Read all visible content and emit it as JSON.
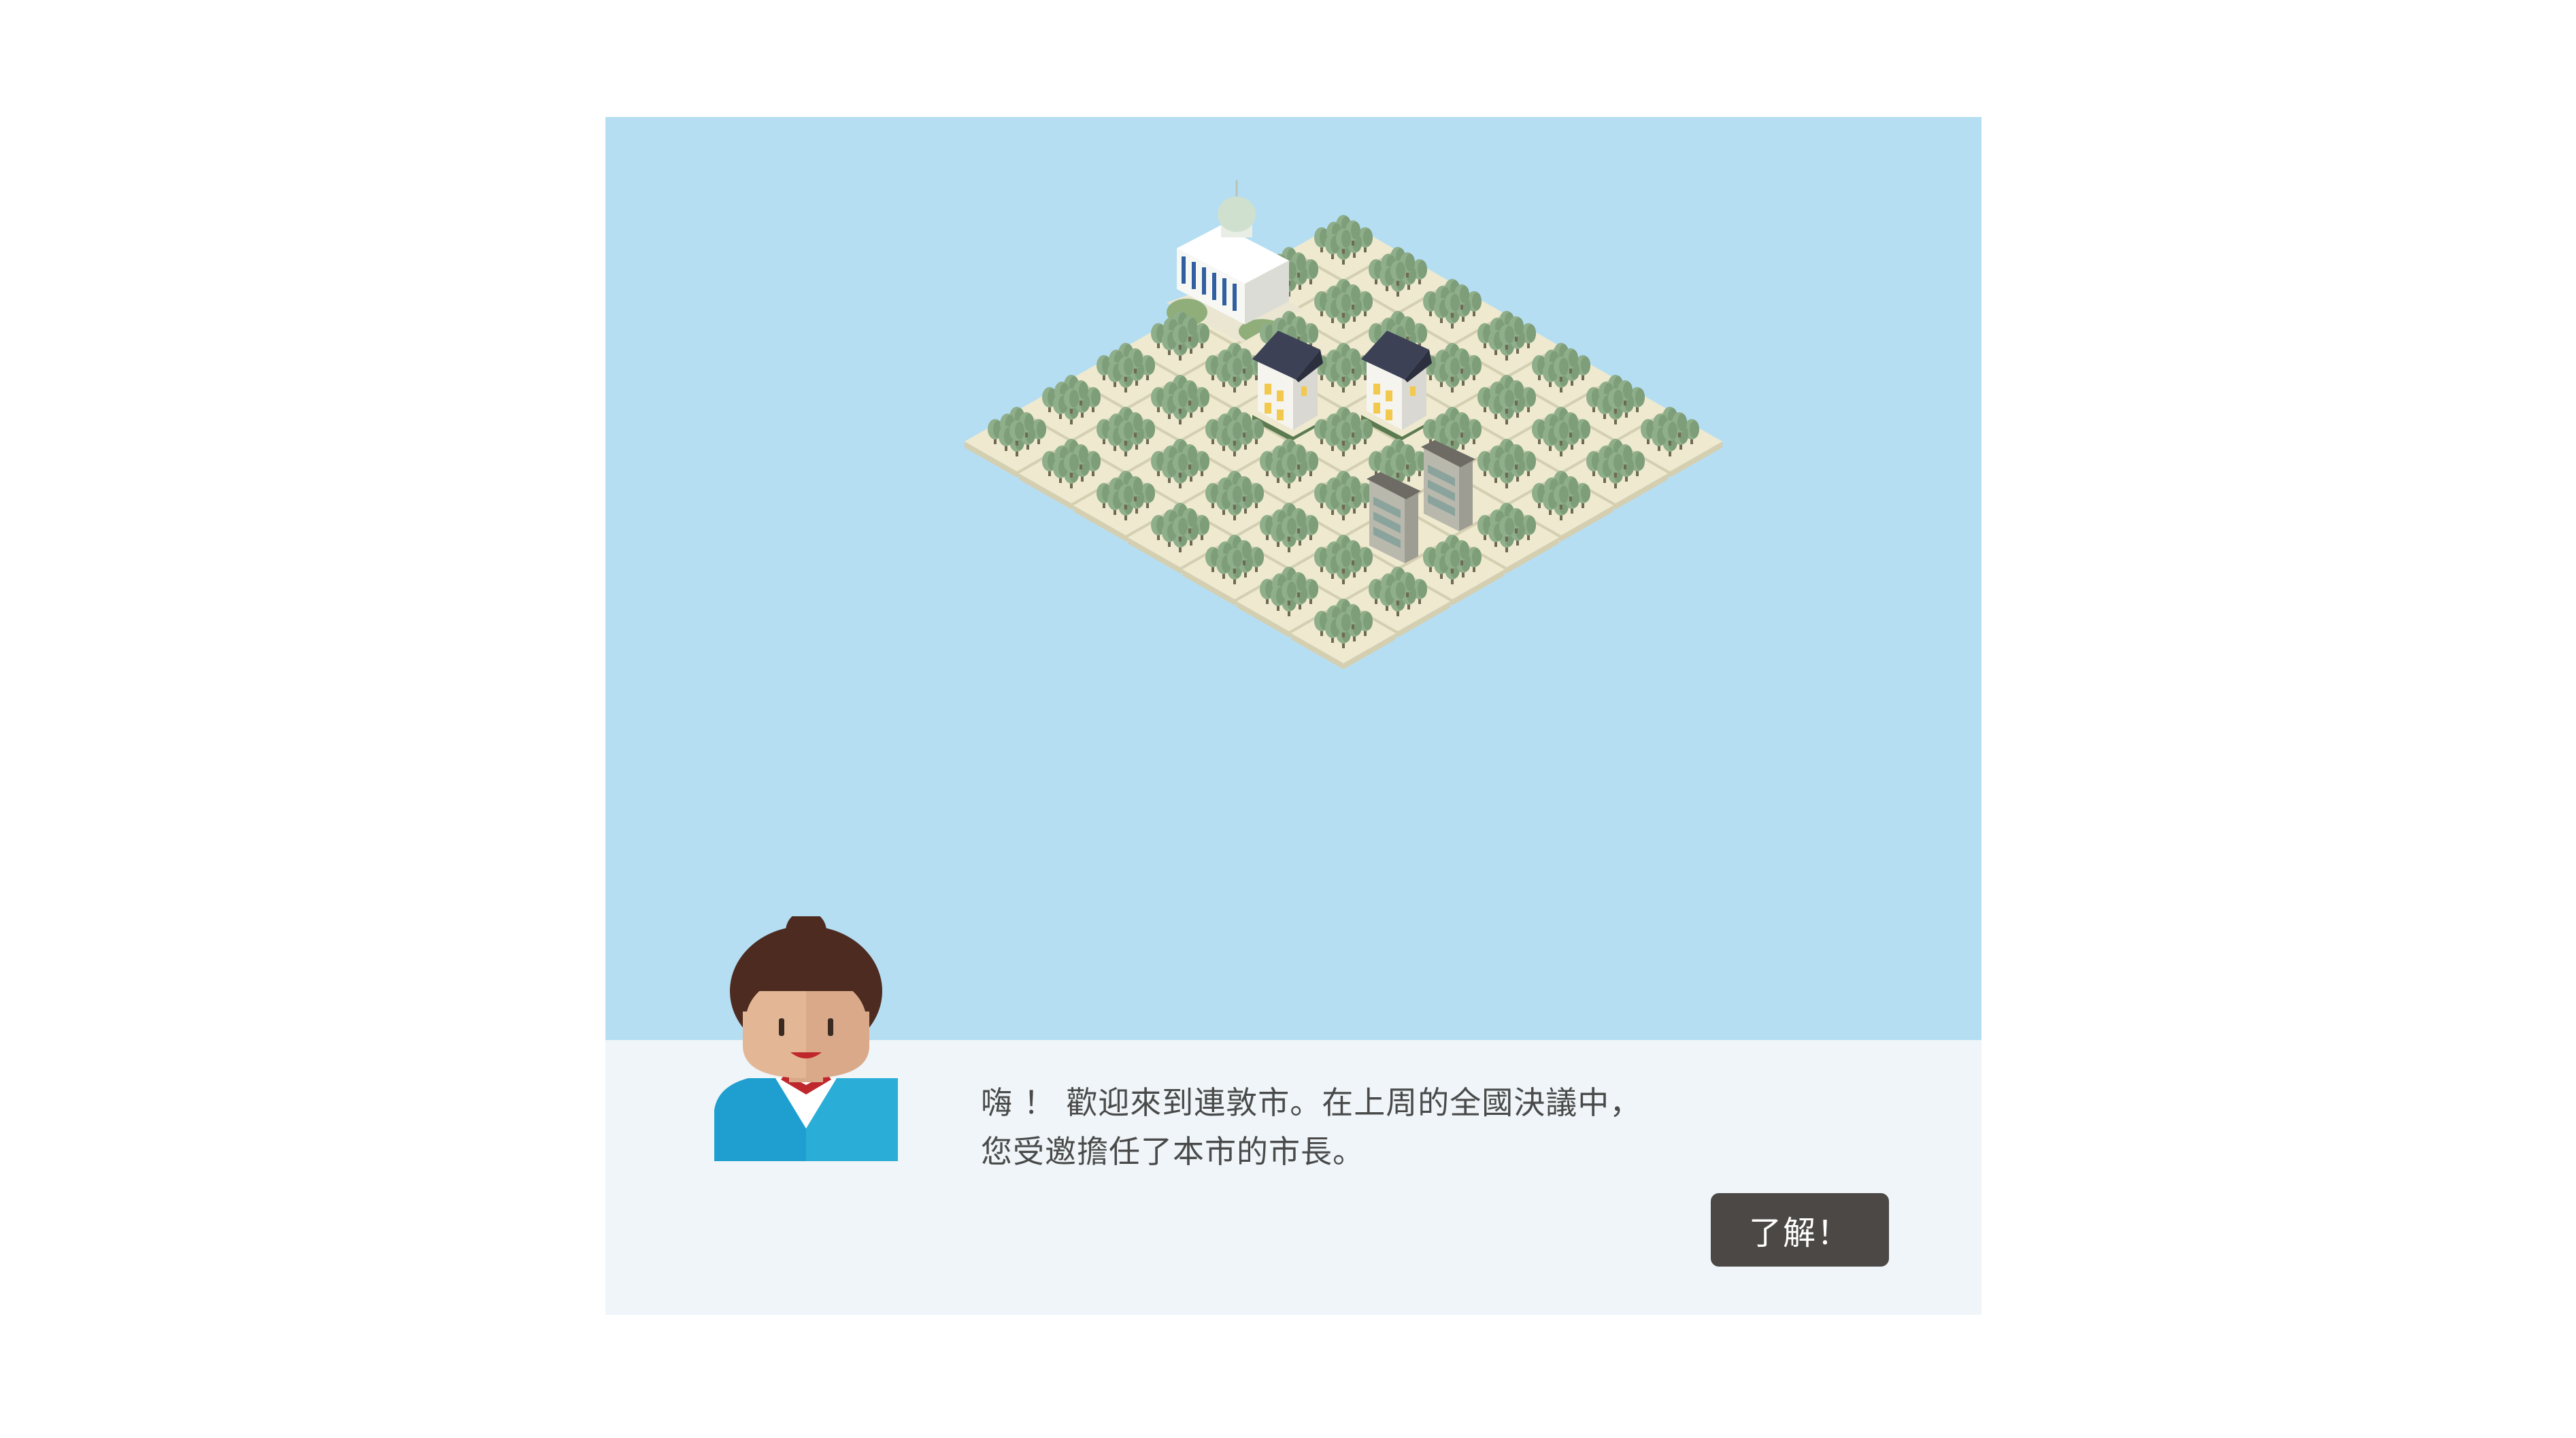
{
  "dialog": {
    "line1": "嗨 ！ 歡迎來到連敦市。在上周的全國決議中，",
    "line2": "您受邀擔任了本市的市長。"
  },
  "buttons": {
    "confirm_label": "了解！"
  },
  "scene": {
    "grid_size": 7,
    "tiles": [
      [
        "forest",
        "forest",
        "forest",
        "forest",
        "forest",
        "forest",
        "forest"
      ],
      [
        "forest",
        "forest",
        "forest",
        "forest",
        "forest",
        "forest",
        "forest"
      ],
      [
        "capitol",
        "forest",
        "forest",
        "house",
        "forest",
        "forest",
        "forest"
      ],
      [
        "forest",
        "forest",
        "house",
        "forest",
        "forest",
        "office",
        "forest"
      ],
      [
        "forest",
        "forest",
        "forest",
        "forest",
        "forest",
        "office",
        "forest"
      ],
      [
        "forest",
        "forest",
        "forest",
        "forest",
        "forest",
        "forest",
        "forest"
      ],
      [
        "forest",
        "forest",
        "forest",
        "forest",
        "forest",
        "forest",
        "forest"
      ]
    ],
    "building_icons": [
      "capitol-icon",
      "house-icon",
      "office-building-icon",
      "tree-icon"
    ]
  },
  "colors": {
    "water": "#b5def3",
    "tile_top": "#eee9cf",
    "tile_side": "#d5cfb1",
    "tree": "#8fae8a",
    "panel": "#eff5f8",
    "button": "#4b4845",
    "text": "#4a4a4a"
  }
}
